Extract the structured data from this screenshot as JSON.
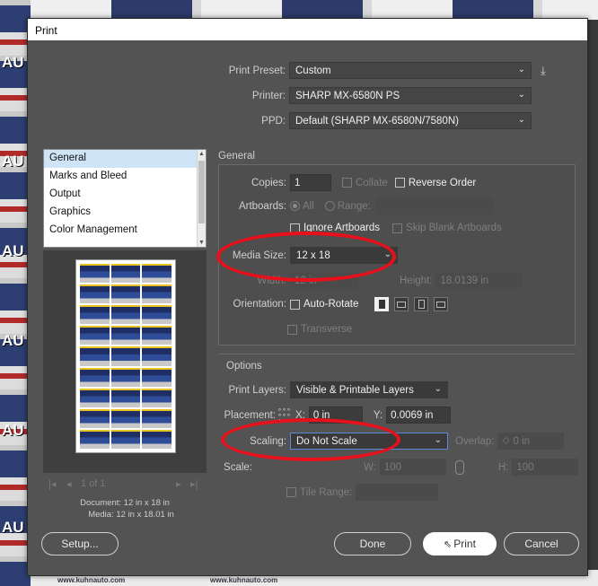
{
  "window": {
    "title": "Print"
  },
  "print_preset": {
    "label": "Print Preset:",
    "value": "Custom"
  },
  "printer": {
    "label": "Printer:",
    "value": "SHARP MX-6580N PS"
  },
  "ppd": {
    "label": "PPD:",
    "value": "Default (SHARP MX-6580N/7580N)"
  },
  "categories": [
    {
      "label": "General",
      "active": true
    },
    {
      "label": "Marks and Bleed"
    },
    {
      "label": "Output"
    },
    {
      "label": "Graphics"
    },
    {
      "label": "Color Management"
    }
  ],
  "general": {
    "title": "General",
    "copies_label": "Copies:",
    "copies_value": "1",
    "collate_label": "Collate",
    "reverse_order_label": "Reverse Order",
    "artboards_label": "Artboards:",
    "all_label": "All",
    "range_label": "Range:",
    "ignore_artboards_label": "Ignore Artboards",
    "skip_blank_label": "Skip Blank Artboards",
    "media_size_label": "Media Size:",
    "media_size_value": "12 x 18",
    "width_label": "Width:",
    "width_value": "12 in",
    "height_label": "Height:",
    "height_value": "18.0139 in",
    "orientation_label": "Orientation:",
    "auto_rotate_label": "Auto-Rotate",
    "transverse_label": "Transverse"
  },
  "options": {
    "title": "Options",
    "print_layers_label": "Print Layers:",
    "print_layers_value": "Visible & Printable Layers",
    "placement_label": "Placement:",
    "x_label": "X:",
    "x_value": "0 in",
    "y_label": "Y:",
    "y_value": "0.0069 in",
    "scaling_label": "Scaling:",
    "scaling_value": "Do Not Scale",
    "overlap_label": "Overlap:",
    "overlap_value": "0 in",
    "scale_label": "Scale:",
    "w_label": "W:",
    "w_value": "100",
    "h_label": "H:",
    "h_value": "100",
    "tile_range_label": "Tile Range:"
  },
  "preview": {
    "page_indicator": "1 of 1",
    "document_label": "Document:",
    "document_value": "12 in x 18 in",
    "media_label": "Media:",
    "media_value": "12 in x 18.01 in"
  },
  "buttons": {
    "setup": "Setup...",
    "done": "Done",
    "print": "Print",
    "cancel": "Cancel"
  },
  "background": {
    "left_brand": "AU",
    "footer_left": "www.kuhnauto.com",
    "footer_right": "www.kuhnauto.com"
  },
  "colors": {
    "dialog_bg": "#535353",
    "highlight": "#e8101b",
    "active_category": "#cfe4f7"
  }
}
